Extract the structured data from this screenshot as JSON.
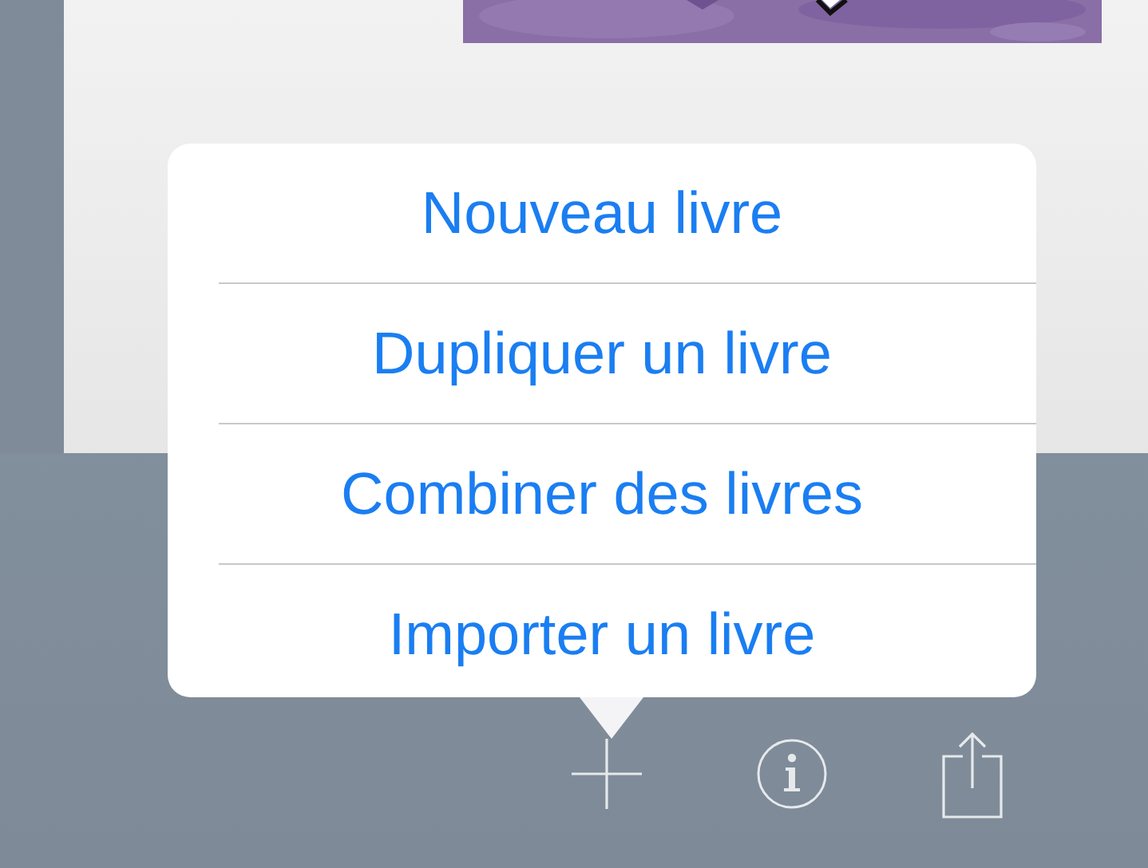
{
  "menu": {
    "items": [
      {
        "label": "Nouveau livre"
      },
      {
        "label": "Dupliquer un livre"
      },
      {
        "label": "Combiner des livres"
      },
      {
        "label": "Importer un livre"
      }
    ]
  }
}
